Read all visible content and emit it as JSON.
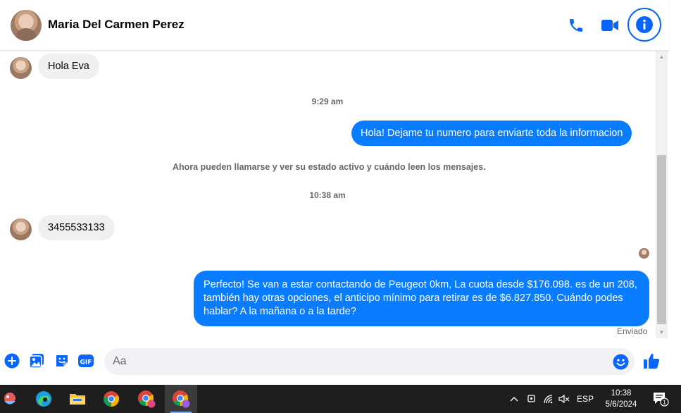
{
  "contact": {
    "name": "Maria Del Carmen Perez"
  },
  "header": {
    "call_icon": "phone-icon",
    "video_icon": "video-camera-icon",
    "info_icon": "info-icon"
  },
  "conversation": {
    "msg1": "Hola Eva",
    "time1": "9:29 am",
    "msg2": "Hola! Dejame tu numero para enviarte toda la informacion",
    "system_note": "Ahora pueden llamarse y ver su estado activo y cuándo leen los mensajes.",
    "time2": "10:38 am",
    "msg3": "3455533133",
    "msg4": "Perfecto!  Se van a estar contactando de Peugeot 0km, La cuota desde $176.098. es de un 208, también hay otras opciones, el anticipo mínimo para retirar es de $6.827.850. Cuándo podes hablar? A la mañana o a la tarde?",
    "status": "Enviado"
  },
  "composer": {
    "placeholder": "Aa",
    "gif_label": "GIF"
  },
  "taskbar": {
    "language": "ESP",
    "time": "10:38",
    "date": "5/6/2024",
    "notification_count": "1"
  },
  "colors": {
    "accent": "#0866ff",
    "outgoing_bubble": "#0a7cff",
    "incoming_bubble": "#f0f0f0"
  }
}
